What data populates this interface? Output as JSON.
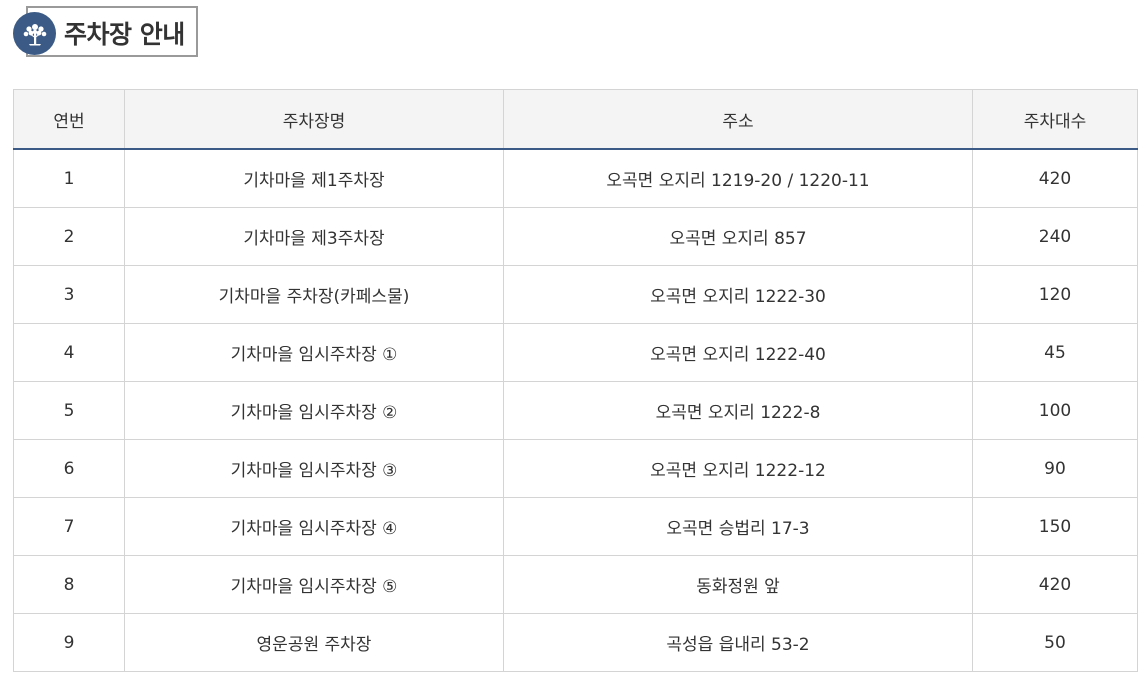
{
  "page": {
    "title": "주차장 안내",
    "icon": "tree-icon",
    "accent_color": "#3b5b86"
  },
  "table": {
    "headers": [
      "연번",
      "주차장명",
      "주소",
      "주차대수"
    ],
    "rows": [
      [
        "1",
        "기차마을 제1주차장",
        "오곡면 오지리 1219-20 / 1220-11",
        "420"
      ],
      [
        "2",
        "기차마을 제3주차장",
        "오곡면 오지리 857",
        "240"
      ],
      [
        "3",
        "기차마을 주차장(카페스물)",
        "오곡면 오지리 1222-30",
        "120"
      ],
      [
        "4",
        "기차마을 임시주차장 ①",
        "오곡면 오지리 1222-40",
        "45"
      ],
      [
        "5",
        "기차마을 임시주차장 ②",
        "오곡면 오지리 1222-8",
        "100"
      ],
      [
        "6",
        "기차마을 임시주차장 ③",
        "오곡면 오지리 1222-12",
        "90"
      ],
      [
        "7",
        "기차마을 임시주차장 ④",
        "오곡면 승법리 17-3",
        "150"
      ],
      [
        "8",
        "기차마을 임시주차장 ⑤",
        "동화정원 앞",
        "420"
      ],
      [
        "9",
        "영운공원 주차장",
        "곡성읍 읍내리 53-2",
        "50"
      ]
    ]
  }
}
